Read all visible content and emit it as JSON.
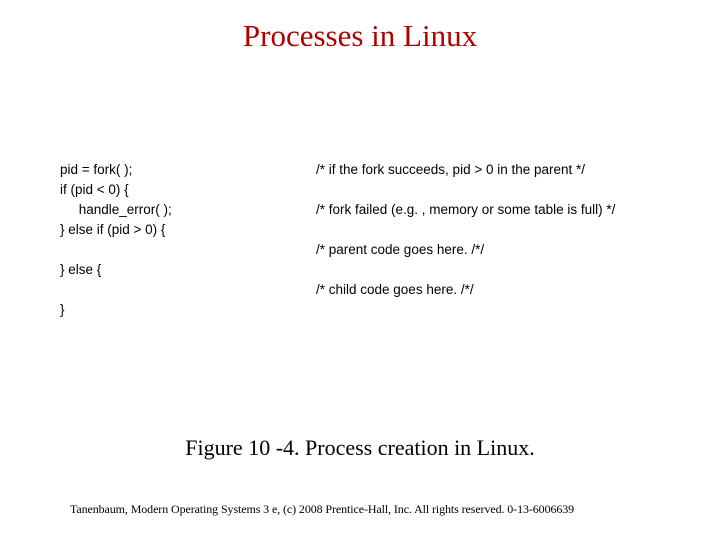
{
  "title": "Processes in Linux",
  "code": {
    "rows": [
      {
        "left": "pid = fork( );",
        "right": "/* if the fork succeeds, pid > 0 in the parent */"
      },
      {
        "left": "if (pid < 0) {",
        "right": ""
      },
      {
        "left": "     handle_error( );",
        "right": "/* fork failed (e.g. , memory or some table is full) */"
      },
      {
        "left": "} else if (pid > 0) {",
        "right": ""
      },
      {
        "left": "",
        "right": "/* parent code goes here. /*/"
      },
      {
        "left": "} else {",
        "right": ""
      },
      {
        "left": "",
        "right": "/* child code goes here. /*/"
      },
      {
        "left": "}",
        "right": ""
      }
    ]
  },
  "caption": "Figure 10 -4. Process creation in Linux.",
  "footer": "Tanenbaum, Modern Operating Systems 3 e, (c) 2008 Prentice-Hall, Inc. All rights reserved. 0-13-6006639"
}
